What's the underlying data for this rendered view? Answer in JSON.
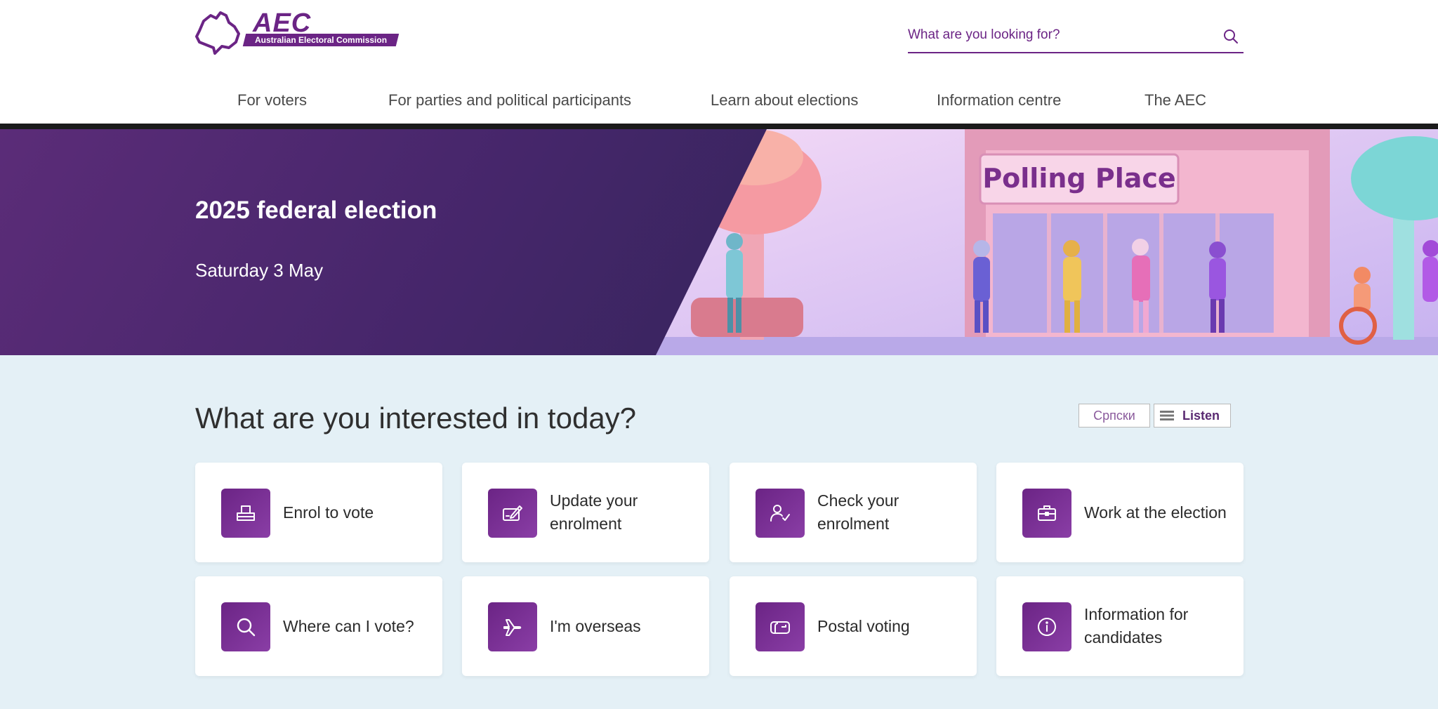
{
  "header": {
    "logo": {
      "brand": "AEC",
      "subtitle": "Australian Electoral Commission"
    },
    "search": {
      "placeholder": "What are you looking for?",
      "icon": "search-icon"
    },
    "nav": [
      {
        "label": "For voters"
      },
      {
        "label": "For parties and political participants"
      },
      {
        "label": "Learn about elections"
      },
      {
        "label": "Information centre"
      },
      {
        "label": "The AEC"
      }
    ]
  },
  "hero": {
    "title": "2025 federal election",
    "date": "Saturday 3 May",
    "sign_text": "Polling Place"
  },
  "main": {
    "heading": "What are you interested in today?",
    "language_button": "Српски",
    "listen_button": "Listen",
    "cards": [
      {
        "label": "Enrol to vote",
        "icon": "ballot-box-icon"
      },
      {
        "label": "Update your enrolment",
        "icon": "edit-card-icon"
      },
      {
        "label": "Check your enrolment",
        "icon": "user-check-icon"
      },
      {
        "label": "Work at the election",
        "icon": "briefcase-icon"
      },
      {
        "label": "Where can I vote?",
        "icon": "search-icon"
      },
      {
        "label": "I'm overseas",
        "icon": "plane-icon"
      },
      {
        "label": "Postal voting",
        "icon": "mailbox-icon"
      },
      {
        "label": "Information for candidates",
        "icon": "info-icon"
      }
    ]
  },
  "colors": {
    "brand_purple": "#6b2485",
    "hero_dark": "#2f2456",
    "page_background": "#e4f0f6"
  }
}
